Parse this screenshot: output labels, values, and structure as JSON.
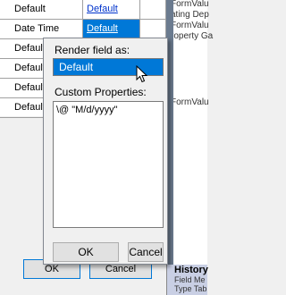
{
  "table": {
    "rows": [
      {
        "name": "Default",
        "value": "Default",
        "selected": false
      },
      {
        "name": "Date Time",
        "value": "Default",
        "selected": true
      },
      {
        "name": "Default",
        "value": "",
        "selected": false
      },
      {
        "name": "Default",
        "value": "",
        "selected": false
      },
      {
        "name": "Default",
        "value": "",
        "selected": false
      },
      {
        "name": "Default",
        "value": "",
        "selected": false
      }
    ]
  },
  "side_panel": {
    "lines": [
      "FormValu",
      "ating Dep",
      "FormValu",
      "roperty Ga",
      "FormValu"
    ]
  },
  "history": {
    "title": "History",
    "line1": "Field Me",
    "line2": "Type   Tab"
  },
  "background_buttons": {
    "ok_partial": "OK",
    "cancel_partial": "Cancel"
  },
  "popup": {
    "render_label": "Render field as:",
    "render_value": "Default",
    "custom_label": "Custom Properties:",
    "custom_value": "\\@ \"M/d/yyyy\"",
    "ok_label": "OK",
    "cancel_label": "Cancel"
  }
}
